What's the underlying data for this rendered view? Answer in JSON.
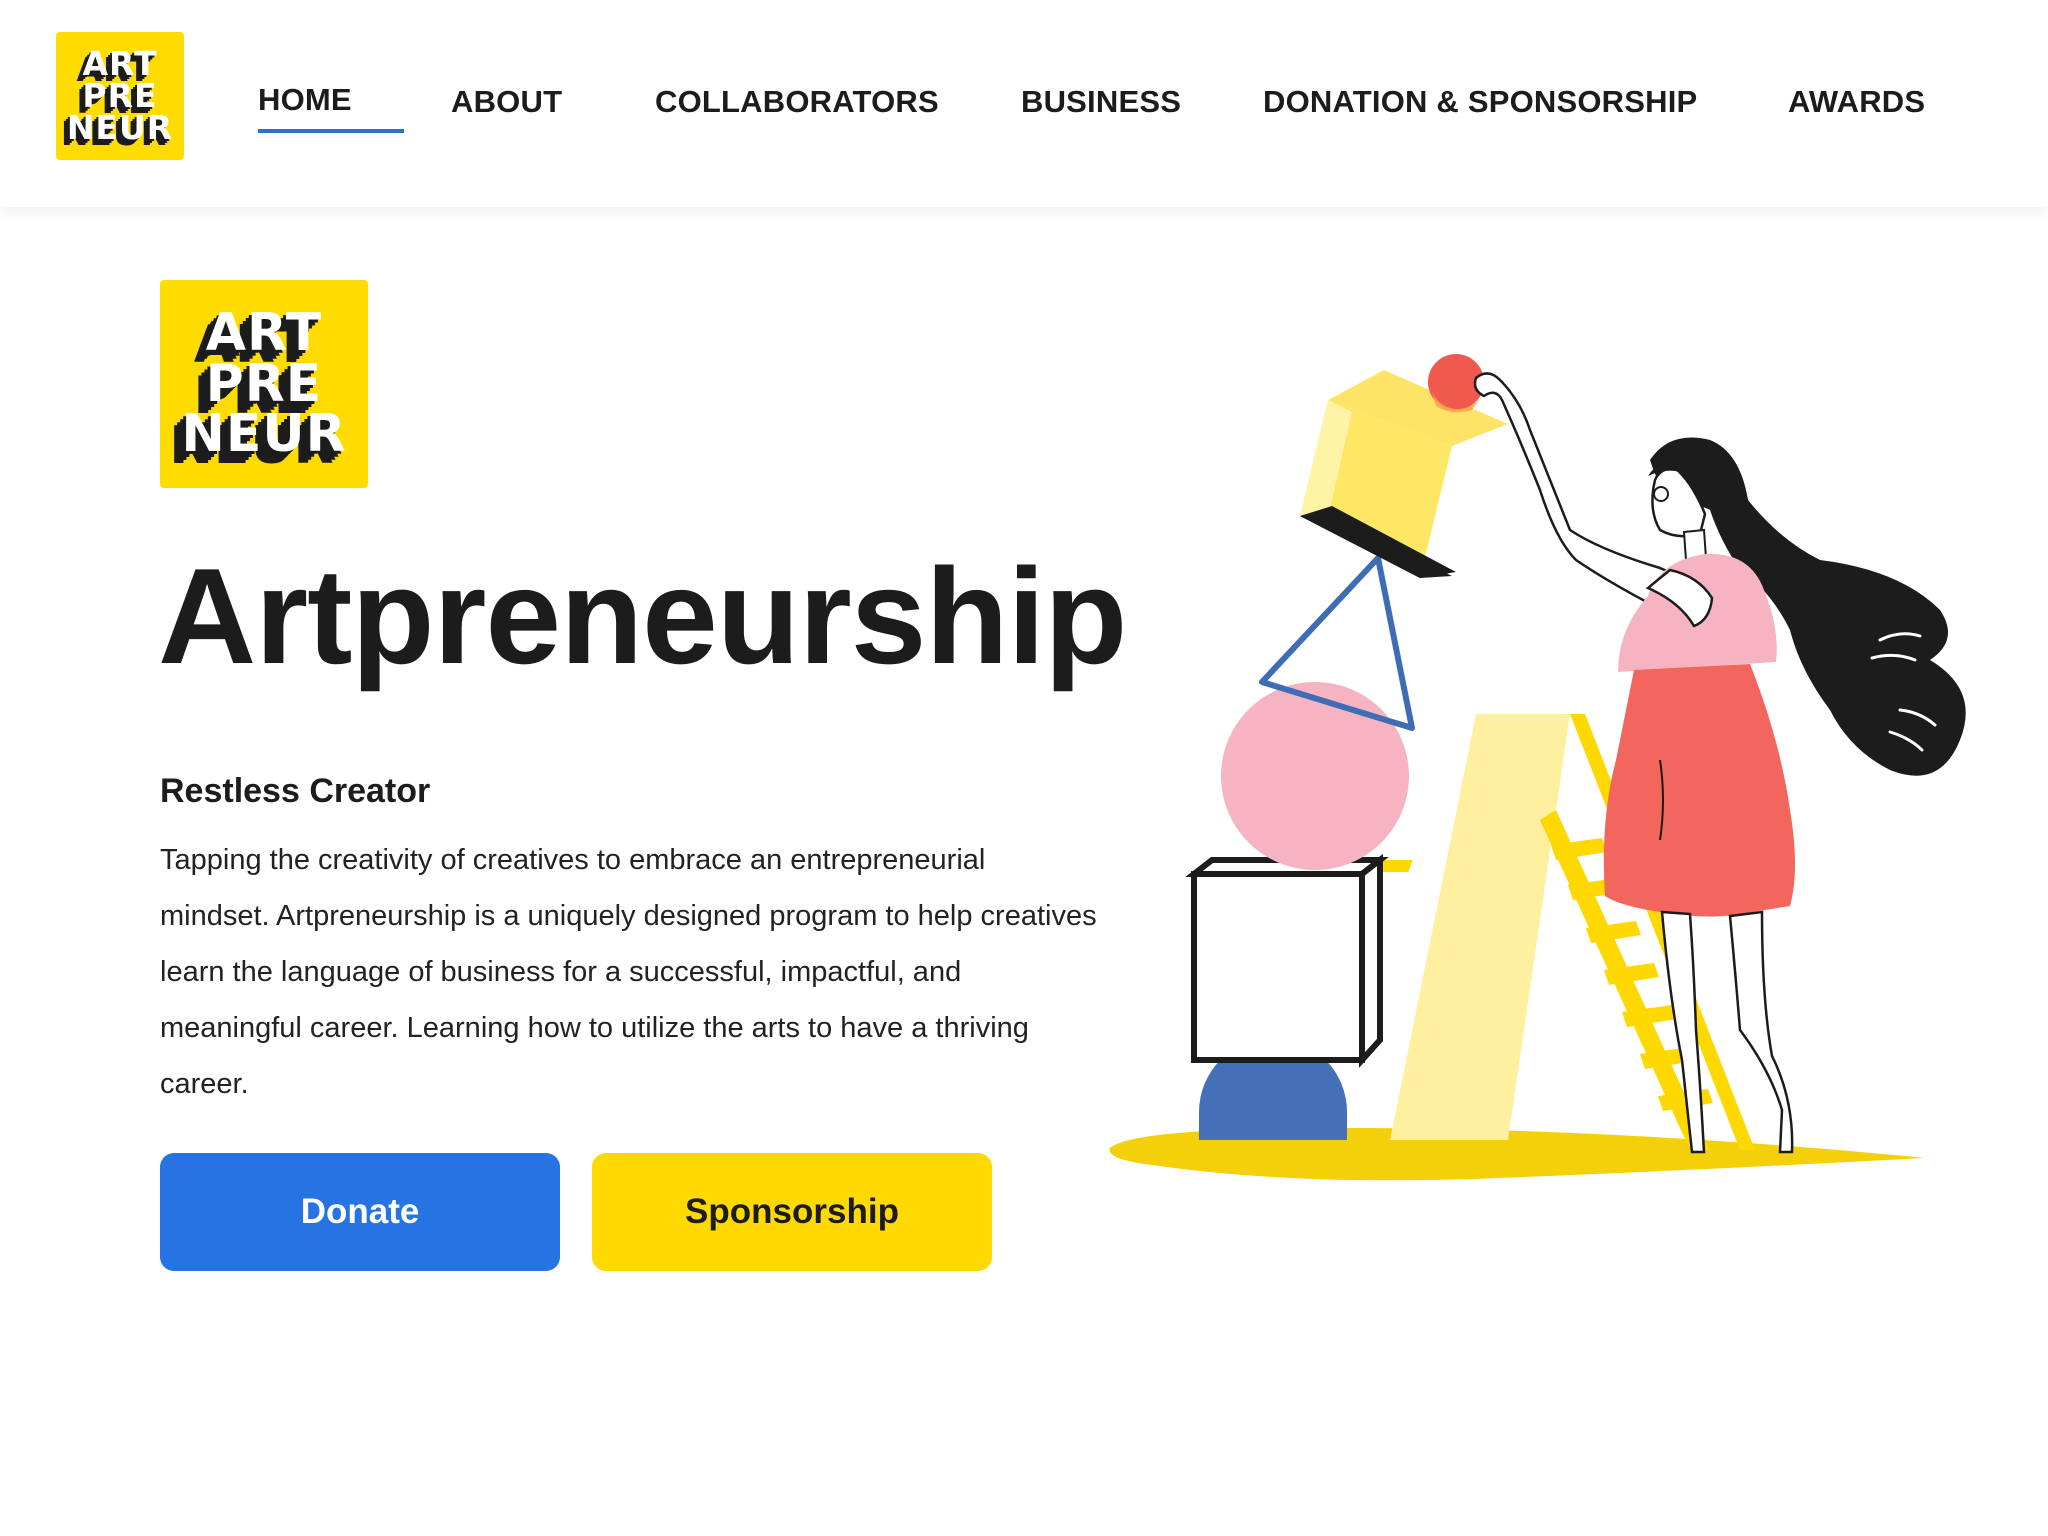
{
  "brand": {
    "logo_lines": [
      "ART",
      "PRE",
      "NEUR"
    ],
    "colors": {
      "yellow": "#ffdc00",
      "blue": "#2674e3",
      "nav_underline": "#2a6fd6",
      "text": "#1c1c1c",
      "pink": "#f6b4c3",
      "coral": "#f2665d"
    }
  },
  "nav": {
    "items": [
      {
        "label": "HOME",
        "active": true
      },
      {
        "label": "ABOUT"
      },
      {
        "label": "COLLABORATORS"
      },
      {
        "label": "BUSINESS"
      },
      {
        "label": "DONATION & SPONSORSHIP"
      },
      {
        "label": "AWARDS"
      }
    ]
  },
  "hero": {
    "title": "Artpreneurship",
    "subtitle": "Restless Creator",
    "body": "Tapping the creativity of creatives to embrace an entrepreneurial mindset. Artpreneurship is a uniquely designed program to help creatives learn the language of business for a successful, impactful, and meaningful career. Learning how to utilize the arts to have a thriving career.",
    "buttons": {
      "donate": "Donate",
      "sponsorship": "Sponsorship"
    }
  }
}
